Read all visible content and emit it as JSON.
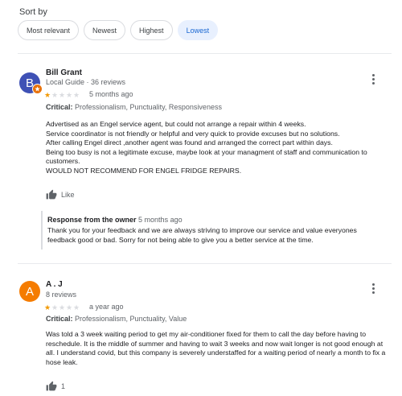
{
  "sort": {
    "label": "Sort by",
    "options": [
      "Most relevant",
      "Newest",
      "Highest",
      "Lowest"
    ],
    "selected": "Lowest"
  },
  "reviews": [
    {
      "avatar_letter": "B",
      "avatar_color": "#3f51b5",
      "name": "Bill Grant",
      "meta": "Local Guide · 36 reviews",
      "rating": 1,
      "time": "5 months ago",
      "critical_label": "Critical:",
      "critical_values": "Professionalism, Punctuality, Responsiveness",
      "text": "Advertised as an Engel service agent, but could not arrange a repair within 4 weeks.\nService coordinator is not friendly or helpful and very quick to provide excuses but no solutions.\nAfter calling Engel direct ,another agent was found and arranged the correct part within days.\nBeing too busy is not a legitimate excuse, maybe look at your managment of staff and communication to customers.\nWOULD NOT RECOMMEND FOR ENGEL FRIDGE REPAIRS.",
      "like_label": "Like",
      "response": {
        "title": "Response from the owner",
        "time": "5 months ago",
        "text": "Thank you for your feedback and we are always striving to improve our service and value everyones feedback good or bad. Sorry for not being able to give you a better service at the time."
      }
    },
    {
      "avatar_letter": "A",
      "avatar_color": "#f57c00",
      "name": "A . J",
      "meta": "8 reviews",
      "rating": 1,
      "time": "a year ago",
      "critical_label": "Critical:",
      "critical_values": "Professionalism, Punctuality, Value",
      "text": "Was told a 3 week waiting period to get my air-conditioner fixed for them to call the day before having to reschedule. It is the middle of summer and having to wait 3 weeks and now wait longer is not good enough at all. I understand covid, but this company is severely understaffed for a waiting period of nearly a month to fix a hose leak.",
      "like_count": "1"
    }
  ]
}
